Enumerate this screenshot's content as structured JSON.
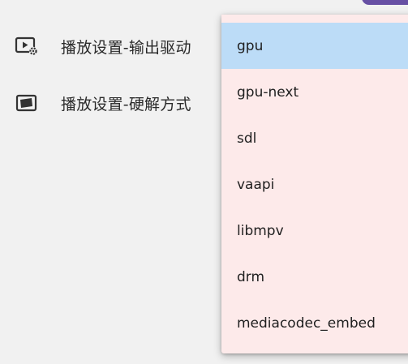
{
  "settings": {
    "items": [
      {
        "icon": "video-settings-icon",
        "label": "播放设置-输出驱动"
      },
      {
        "icon": "picture-frame-icon",
        "label": "播放设置-硬解方式"
      }
    ]
  },
  "menu": {
    "selected": "gpu",
    "options": [
      {
        "label": "gpu",
        "selected": true
      },
      {
        "label": "gpu-next",
        "selected": false
      },
      {
        "label": "sdl",
        "selected": false
      },
      {
        "label": "vaapi",
        "selected": false
      },
      {
        "label": "libmpv",
        "selected": false
      },
      {
        "label": "drm",
        "selected": false
      },
      {
        "label": "mediacodec_embed",
        "selected": false
      }
    ]
  },
  "colors": {
    "background": "#f1f1f1",
    "menu_background": "#fdeaea",
    "selected_item": "#bcdcf7",
    "accent": "#6750a4"
  }
}
